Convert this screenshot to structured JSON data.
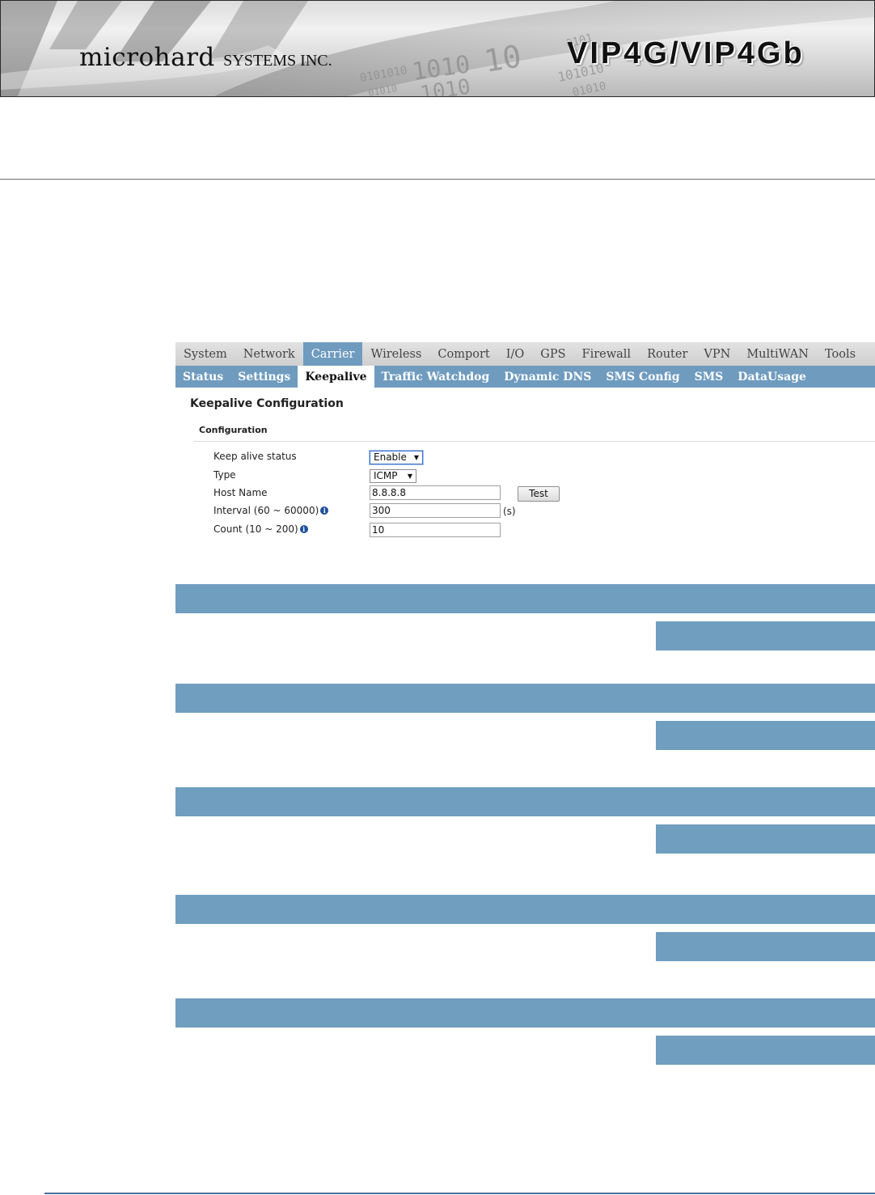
{
  "header": {
    "brand_name": "microhard",
    "brand_suffix": "SYSTEMS INC.",
    "product": "VIP4G/VIP4Gb"
  },
  "ui": {
    "top_nav": [
      "System",
      "Network",
      "Carrier",
      "Wireless",
      "Comport",
      "I/O",
      "GPS",
      "Firewall",
      "Router",
      "VPN",
      "MultiWAN",
      "Tools"
    ],
    "top_nav_active": "Carrier",
    "sub_nav": [
      "Status",
      "Settings",
      "Keepalive",
      "Traffic Watchdog",
      "Dynamic DNS",
      "SMS Config",
      "SMS",
      "DataUsage"
    ],
    "sub_nav_active": "Keepalive",
    "page_title": "Keepalive Configuration",
    "section_title": "Configuration",
    "fields": {
      "keep_alive_status": {
        "label": "Keep alive status",
        "value": "Enable"
      },
      "type": {
        "label": "Type",
        "value": "ICMP"
      },
      "host_name": {
        "label": "Host Name",
        "value": "8.8.8.8",
        "button": "Test"
      },
      "interval": {
        "label": "Interval (60 ~ 60000)",
        "value": "300",
        "unit": "(s)"
      },
      "count": {
        "label": "Count (10 ~ 200)",
        "value": "10"
      }
    }
  },
  "colors": {
    "nav_blue": "#6f9bbf",
    "bar_blue": "#6f9ebf",
    "footer_rule": "#4a6e9a"
  },
  "icons": {
    "info": "info-icon",
    "dropdown": "caret-down-icon"
  }
}
